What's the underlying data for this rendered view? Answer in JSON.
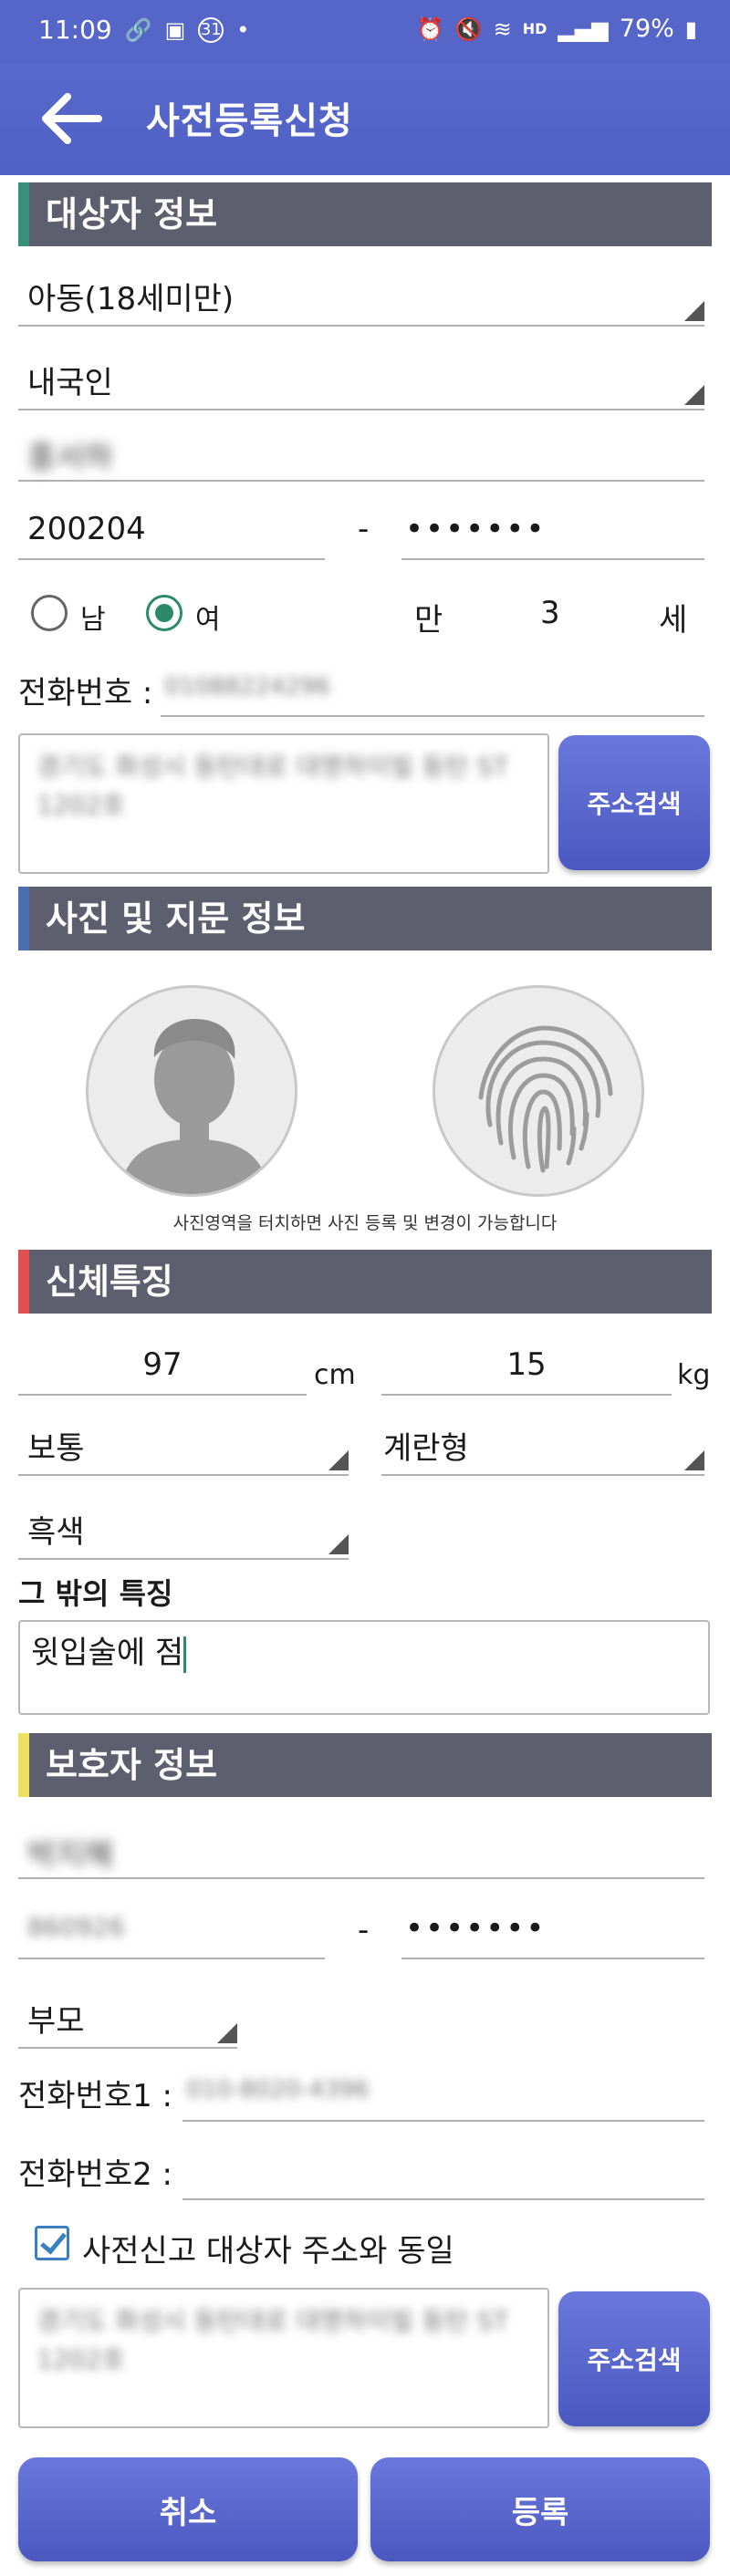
{
  "status_bar": {
    "time": "11:09",
    "calendar_day": "31",
    "hd_label": "HD",
    "battery": "79%"
  },
  "app_bar": {
    "title": "사전등록신청"
  },
  "target_info": {
    "section_title": "대상자 정보",
    "accent_color": "#3a8f7a",
    "age_group": "아동(18세미만)",
    "nationality": "내국인",
    "name": "홍서하",
    "birth_front": "200204",
    "id_separator": "-",
    "id_back": "•••••••",
    "gender_male": "남",
    "gender_female": "여",
    "age_prefix": "만",
    "age_value": "3",
    "age_suffix": "세",
    "phone_label": "전화번호 :",
    "phone_value": "01088224296",
    "address": "경기도 화성시 동탄대로 대명하이빌 동탄 ST 1202호",
    "address_search": "주소검색"
  },
  "photo_info": {
    "section_title": "사진 및 지문 정보",
    "accent_color": "#4a6fb0",
    "caption": "사진영역을 터치하면 사진 등록 및 변경이 가능합니다"
  },
  "body_features": {
    "section_title": "신체특징",
    "accent_color": "#e05050",
    "height": "97",
    "height_unit": "cm",
    "weight": "15",
    "weight_unit": "kg",
    "body_type": "보통",
    "face_shape": "계란형",
    "hair_color": "흑색",
    "other_label": "그 밖의 특징",
    "other_value": "윗입술에 점"
  },
  "guardian_info": {
    "section_title": "보호자 정보",
    "accent_color": "#f0e060",
    "name": "박지혜",
    "birth_front": "860926",
    "id_separator": "-",
    "id_back": "•••••••",
    "relation": "부모",
    "phone1_label": "전화번호1 :",
    "phone1_value": "010-8020-4396",
    "phone2_label": "전화번호2 :",
    "same_address_label": "사전신고 대상자 주소와 동일",
    "address": "경기도 화성시 동탄대로 대명하이빌 동탄 ST 1202호",
    "address_search": "주소검색"
  },
  "actions": {
    "cancel": "취소",
    "register": "등록"
  }
}
